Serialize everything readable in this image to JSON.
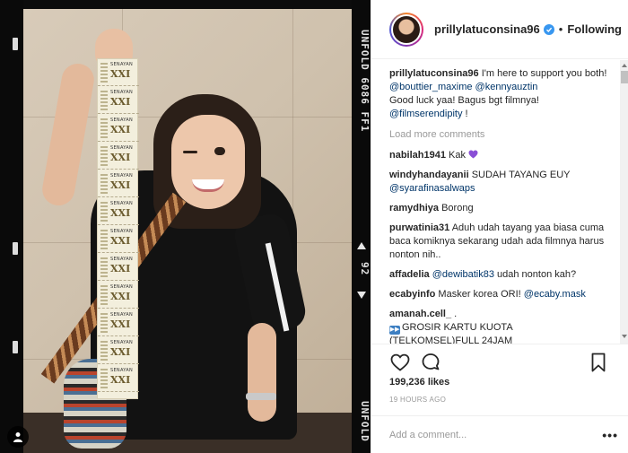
{
  "film": {
    "top_text": "UNFOLD 6086 FF1",
    "mid_text": "92",
    "bottom_text": "UNFOLD"
  },
  "ticket": {
    "top": "SENAYAN",
    "mark": "XXI"
  },
  "post": {
    "username": "prillylatuconsina96",
    "follow_status": "Following",
    "separator": "•",
    "caption": {
      "user": "prillylatuconsina96",
      "line1": "I'm here to support you both!",
      "mention1": "@bouttier_maxime",
      "mention2": "@kennyauztin",
      "line2": "Good luck yaa! Bagus bgt filmnya!",
      "mention3": "@filmserendipity",
      "tail": " !"
    },
    "load_more": "Load more comments",
    "comments": [
      {
        "user": "nabilah1941",
        "text": "Kak "
      },
      {
        "user": "windyhandayanii",
        "text": "SUDAH TAYANG EUY",
        "mention": "@syarafinasalwaps"
      },
      {
        "user": "ramydhiya",
        "text": "Borong"
      },
      {
        "user": "purwatinia31",
        "text": "Aduh udah tayang yaa biasa cuma baca komiknya sekarang udah ada filmnya harus nonton nih.."
      },
      {
        "user": "affadelia",
        "mention": "@dewibatik83",
        "text": " udah nonton kah?"
      },
      {
        "user": "ecabyinfo",
        "text": "Masker korea ORI! ",
        "mention": "@ecaby.mask"
      },
      {
        "user": "amanah.cell_",
        "text": ".",
        "line2": "GROSIR KARTU KUOTA",
        "line3": "(TELKOMSEL)FULL 24JAM"
      }
    ],
    "likes": "199,236 likes",
    "time": "19 HOURS AGO",
    "add_comment_placeholder": "Add a comment...",
    "more_label": "•••"
  },
  "colors": {
    "link": "#003569",
    "verified": "#3897f0",
    "heart_emoji": "#8a4fd6"
  },
  "icons": {
    "like": "heart-outline-icon",
    "comment": "speech-bubble-icon",
    "save": "bookmark-icon",
    "verified": "verified-badge-icon",
    "user_tag": "user-tag-icon"
  }
}
